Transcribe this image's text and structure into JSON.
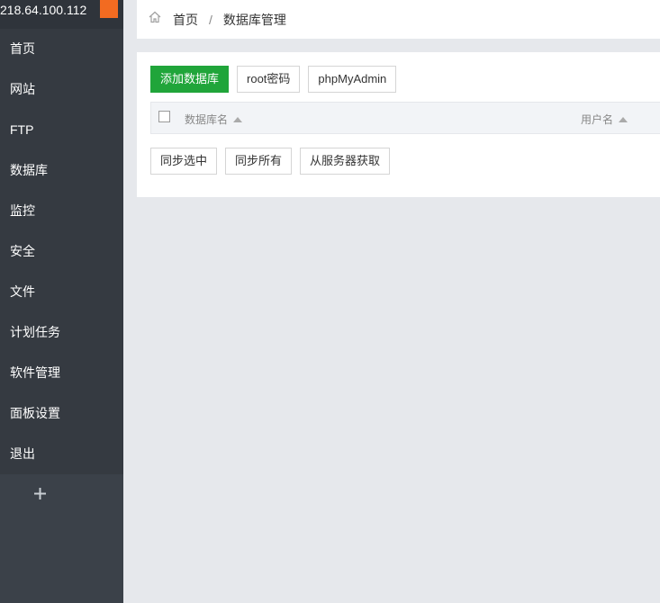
{
  "sidebar": {
    "ip": "218.64.100.112",
    "accent_color": "#f26b21",
    "items": [
      {
        "label": "首页"
      },
      {
        "label": "网站"
      },
      {
        "label": "FTP"
      },
      {
        "label": "数据库"
      },
      {
        "label": "监控"
      },
      {
        "label": "安全"
      },
      {
        "label": "文件"
      },
      {
        "label": "计划任务"
      },
      {
        "label": "软件管理"
      },
      {
        "label": "面板设置"
      },
      {
        "label": "退出"
      }
    ],
    "add_icon": "plus-icon"
  },
  "breadcrumb": {
    "icon": "home-icon",
    "home": "首页",
    "separator": "/",
    "current": "数据库管理"
  },
  "toolbar": {
    "add_db": "添加数据库",
    "root_pwd": "root密码",
    "phpmyadmin": "phpMyAdmin",
    "primary_color": "#20a53a"
  },
  "table": {
    "columns": [
      {
        "label": "数据库名"
      },
      {
        "label": "用户名"
      }
    ]
  },
  "actions": {
    "sync_selected": "同步选中",
    "sync_all": "同步所有",
    "fetch_from_server": "从服务器获取"
  }
}
